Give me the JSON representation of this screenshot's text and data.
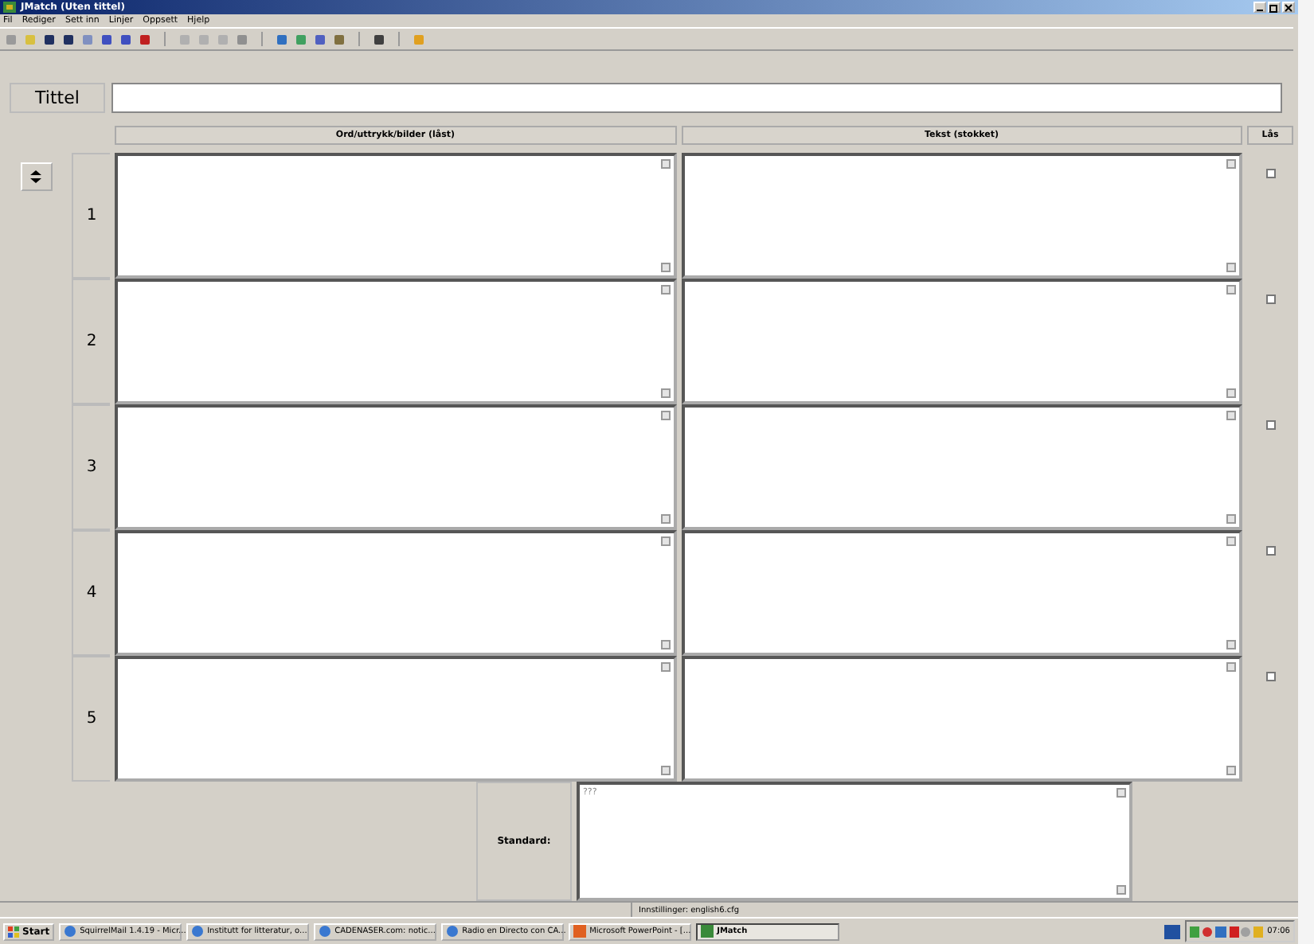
{
  "window": {
    "title": "JMatch (Uten tittel)"
  },
  "menu": [
    "Fil",
    "Rediger",
    "Sett inn",
    "Linjer",
    "Oppsett",
    "Hjelp"
  ],
  "title_field": {
    "label": "Tittel"
  },
  "columns": [
    "Ord/uttrykk/bilder (låst)",
    "Tekst (stokket)",
    "Lås"
  ],
  "rows": [
    {
      "number": "1",
      "locked": false
    },
    {
      "number": "2",
      "locked": false
    },
    {
      "number": "3",
      "locked": false
    },
    {
      "number": "4",
      "locked": false
    },
    {
      "number": "5",
      "locked": false
    }
  ],
  "standard": {
    "label": "Standard:",
    "value": "???"
  },
  "status_bar": "Innstillinger: english6.cfg",
  "taskbar": {
    "start": "Start",
    "items": [
      {
        "label": "SquirrelMail 1.4.19 - Micr...",
        "kind": "browser",
        "selected": false
      },
      {
        "label": "Institutt for litteratur, o...",
        "kind": "browser",
        "selected": false
      },
      {
        "label": "CADENASER.com: notic...",
        "kind": "browser",
        "selected": false
      },
      {
        "label": "Radio en Directo con CA...",
        "kind": "browser",
        "selected": false
      },
      {
        "label": "Microsoft PowerPoint - [...",
        "kind": "slides",
        "selected": false
      },
      {
        "label": "JMatch",
        "kind": "app",
        "selected": true
      }
    ],
    "clock": "07:06"
  }
}
